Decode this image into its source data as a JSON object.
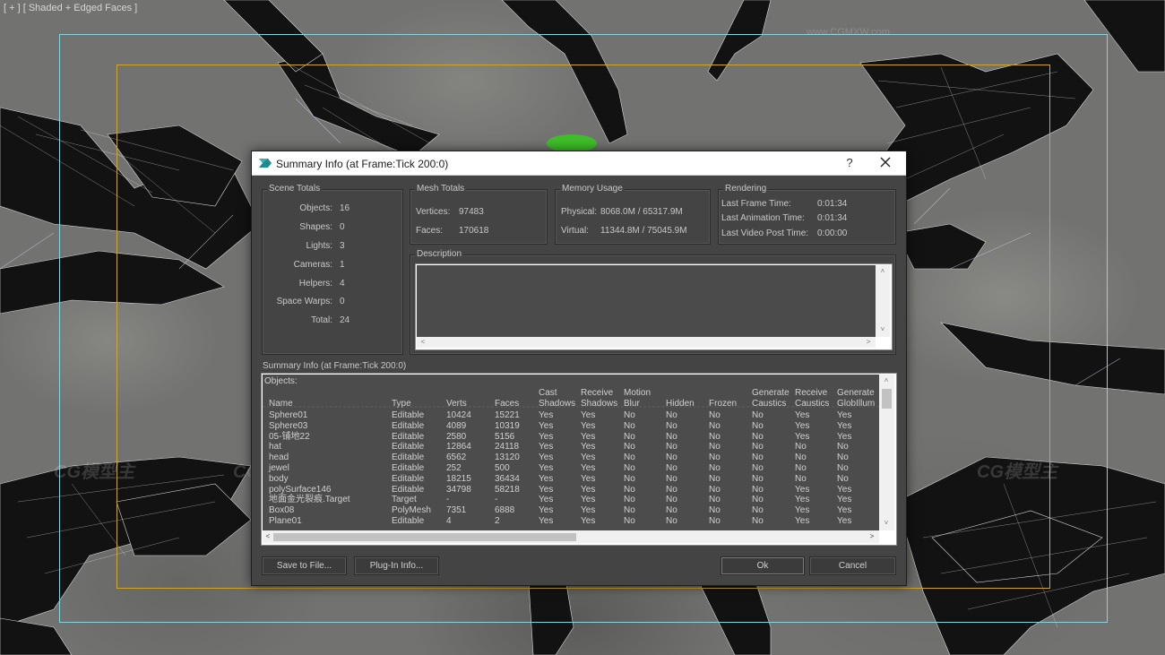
{
  "viewport": {
    "label": "[ + ] [ Shaded + Edged Faces ]",
    "watermark_url": "www.CGMXW.com",
    "watermark_logo": "CG模型主"
  },
  "dialog": {
    "title": "Summary Info (at Frame:Tick 200:0)",
    "help": "?",
    "close": "✕",
    "scene_totals": {
      "title": "Scene Totals",
      "rows": [
        {
          "label": "Objects:",
          "value": "16"
        },
        {
          "label": "Shapes:",
          "value": "0"
        },
        {
          "label": "Lights:",
          "value": "3"
        },
        {
          "label": "Cameras:",
          "value": "1"
        },
        {
          "label": "Helpers:",
          "value": "4"
        },
        {
          "label": "Space Warps:",
          "value": "0"
        },
        {
          "label": "Total:",
          "value": "24"
        }
      ]
    },
    "mesh_totals": {
      "title": "Mesh Totals",
      "vertices_label": "Vertices:",
      "vertices": "97483",
      "faces_label": "Faces:",
      "faces": "170618"
    },
    "memory_usage": {
      "title": "Memory Usage",
      "physical_label": "Physical:",
      "physical": "8068.0M / 65317.9M",
      "virtual_label": "Virtual:",
      "virtual": "11344.8M / 75045.9M"
    },
    "rendering": {
      "title": "Rendering",
      "last_frame_label": "Last Frame Time:",
      "last_frame": "0:01:34",
      "last_anim_label": "Last Animation Time:",
      "last_anim": "0:01:34",
      "last_video_label": "Last Video Post Time:",
      "last_video": "0:00:00"
    },
    "description": {
      "title": "Description"
    },
    "summary": {
      "label": "Summary Info (at Frame:Tick 200:0)",
      "objects_label": "Objects:",
      "headers": {
        "name": "Name",
        "type": "Type",
        "verts": "Verts",
        "faces": "Faces",
        "cast1": "Cast",
        "cast2": "Shadows",
        "recv1": "Receive",
        "recv2": "Shadows",
        "motion1": "Motion",
        "motion2": "Blur",
        "hidden": "Hidden",
        "frozen": "Frozen",
        "gcaus1": "Generate",
        "gcaus2": "Caustics",
        "rcaus1": "Receive",
        "rcaus2": "Caustics",
        "gillum1": "Generate",
        "gillum2": "GlobIllum"
      },
      "rows": [
        {
          "name": "Sphere01",
          "type": "Editable",
          "verts": "10424",
          "faces": "15221",
          "cast": "Yes",
          "recv": "Yes",
          "motion": "No",
          "hidden": "No",
          "frozen": "No",
          "gcaus": "No",
          "rcaus": "Yes",
          "gillum": "Yes"
        },
        {
          "name": "Sphere03",
          "type": "Editable",
          "verts": "4089",
          "faces": "10319",
          "cast": "Yes",
          "recv": "Yes",
          "motion": "No",
          "hidden": "No",
          "frozen": "No",
          "gcaus": "No",
          "rcaus": "Yes",
          "gillum": "Yes"
        },
        {
          "name": "05-铺地22",
          "type": "Editable",
          "verts": "2580",
          "faces": "5156",
          "cast": "Yes",
          "recv": "Yes",
          "motion": "No",
          "hidden": "No",
          "frozen": "No",
          "gcaus": "No",
          "rcaus": "Yes",
          "gillum": "Yes"
        },
        {
          "name": "hat",
          "type": "Editable",
          "verts": "12864",
          "faces": "24118",
          "cast": "Yes",
          "recv": "Yes",
          "motion": "No",
          "hidden": "No",
          "frozen": "No",
          "gcaus": "No",
          "rcaus": "No",
          "gillum": "No"
        },
        {
          "name": "head",
          "type": "Editable",
          "verts": "6562",
          "faces": "13120",
          "cast": "Yes",
          "recv": "Yes",
          "motion": "No",
          "hidden": "No",
          "frozen": "No",
          "gcaus": "No",
          "rcaus": "No",
          "gillum": "No"
        },
        {
          "name": "jewel",
          "type": "Editable",
          "verts": "252",
          "faces": "500",
          "cast": "Yes",
          "recv": "Yes",
          "motion": "No",
          "hidden": "No",
          "frozen": "No",
          "gcaus": "No",
          "rcaus": "No",
          "gillum": "No"
        },
        {
          "name": "body",
          "type": "Editable",
          "verts": "18215",
          "faces": "36434",
          "cast": "Yes",
          "recv": "Yes",
          "motion": "No",
          "hidden": "No",
          "frozen": "No",
          "gcaus": "No",
          "rcaus": "No",
          "gillum": "No"
        },
        {
          "name": "polySurface146",
          "type": "Editable",
          "verts": "34798",
          "faces": "58218",
          "cast": "Yes",
          "recv": "Yes",
          "motion": "No",
          "hidden": "No",
          "frozen": "No",
          "gcaus": "No",
          "rcaus": "Yes",
          "gillum": "Yes"
        },
        {
          "name": "地面金光裂痕.Target",
          "type": "Target",
          "verts": "-",
          "faces": "-",
          "cast": "Yes",
          "recv": "Yes",
          "motion": "No",
          "hidden": "No",
          "frozen": "No",
          "gcaus": "No",
          "rcaus": "Yes",
          "gillum": "Yes"
        },
        {
          "name": "Box08",
          "type": "PolyMesh",
          "verts": "7351",
          "faces": "6888",
          "cast": "Yes",
          "recv": "Yes",
          "motion": "No",
          "hidden": "No",
          "frozen": "No",
          "gcaus": "No",
          "rcaus": "Yes",
          "gillum": "Yes"
        },
        {
          "name": "Plane01",
          "type": "Editable",
          "verts": "4",
          "faces": "2",
          "cast": "Yes",
          "recv": "Yes",
          "motion": "No",
          "hidden": "No",
          "frozen": "No",
          "gcaus": "No",
          "rcaus": "Yes",
          "gillum": "Yes"
        }
      ]
    },
    "buttons": {
      "save": "Save to File...",
      "plugin": "Plug-In Info...",
      "ok": "Ok",
      "cancel": "Cancel"
    }
  }
}
